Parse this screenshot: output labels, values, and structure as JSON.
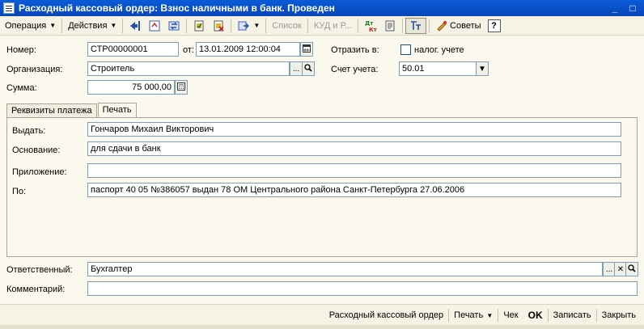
{
  "window": {
    "title": "Расходный кассовый ордер: Взнос наличными в банк. Проведен",
    "controls": [
      "_",
      "□"
    ]
  },
  "toolbar": {
    "operation_label": "Операция",
    "actions_label": "Действия",
    "list_label": "Список",
    "kud_label": "КУД и Р...",
    "advice_label": "Советы",
    "help_glyph": "?",
    "dtkt_label": "Дт Кт"
  },
  "form": {
    "number_label": "Номер:",
    "number_value": "СТР00000001",
    "from_label": "от:",
    "date_value": "13.01.2009 12:00:04",
    "reflect_label": "Отразить в:",
    "tax_label": "налог. учете",
    "tax_checked": false,
    "org_label": "Организация:",
    "org_value": "Строитель",
    "account_label": "Счет учета:",
    "account_value": "50.01",
    "sum_label": "Сумма:",
    "sum_value": "75 000,00"
  },
  "tabs": [
    {
      "label": "Реквизиты платежа",
      "active": false
    },
    {
      "label": "Печать",
      "active": true
    }
  ],
  "print_tab": {
    "issue_label": "Выдать:",
    "issue_value": "Гончаров Михаил Викторович",
    "basis_label": "Основание:",
    "basis_value": "для сдачи в банк",
    "attachment_label": "Приложение:",
    "attachment_value": "",
    "doc_label": "По:",
    "doc_value": "паспорт 40 05 №386057 выдан 78 ОМ Центрального района Санкт-Петербурга 27.06.2006"
  },
  "footer": {
    "responsible_label": "Ответственный:",
    "responsible_value": "Бухгалтер",
    "comment_label": "Комментарий:",
    "comment_value": ""
  },
  "bottom": {
    "form_name": "Расходный кассовый ордер",
    "print_label": "Печать",
    "check_label": "Чек",
    "ok_label": "OK",
    "save_label": "Записать",
    "close_label": "Закрыть"
  }
}
